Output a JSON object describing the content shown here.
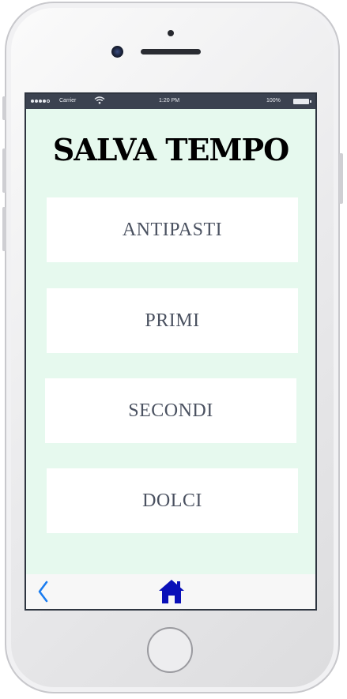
{
  "status_bar": {
    "carrier": "Carrier",
    "time": "1:20 PM",
    "battery": "100%",
    "wifi_icon": "wifi-icon"
  },
  "app": {
    "title": "SALVA TEMPO"
  },
  "menu": [
    {
      "label": "ANTIPASTI"
    },
    {
      "label": "PRIMI"
    },
    {
      "label": "SECONDI"
    },
    {
      "label": "DOLCI"
    }
  ],
  "nav": {
    "back_icon": "chevron-left-icon",
    "home_icon": "home-icon"
  },
  "colors": {
    "background": "#e6f9ee",
    "button_bg": "#ffffff",
    "button_text": "#4a5160",
    "status_bar": "#3b4250",
    "home_icon": "#0a10b8",
    "back_icon": "#1a7cf0"
  }
}
